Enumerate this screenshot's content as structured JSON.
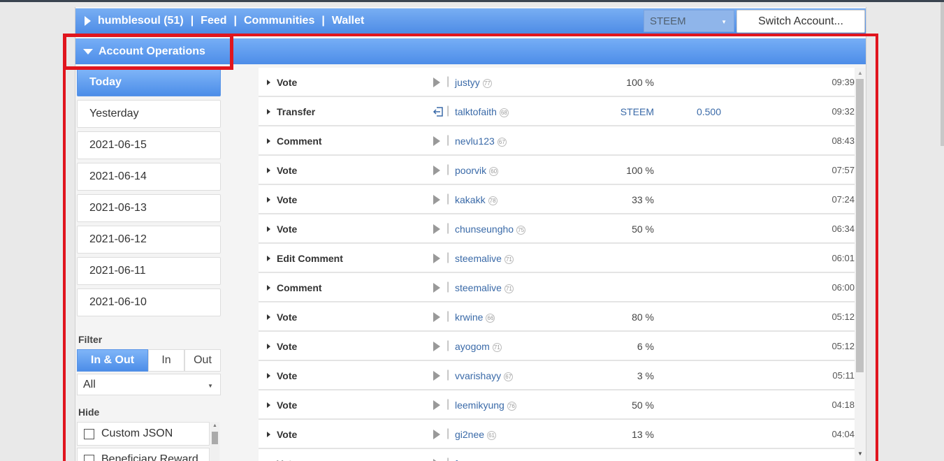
{
  "topbar": {
    "nav": [
      "humblesoul (51)",
      "Feed",
      "Communities",
      "Wallet"
    ],
    "separator": "|",
    "currency": "STEEM",
    "switch_label": "Switch Account..."
  },
  "ops": {
    "title": "Account Operations"
  },
  "sidebar": {
    "days": [
      "Today",
      "Yesterday",
      "2021-06-15",
      "2021-06-14",
      "2021-06-13",
      "2021-06-12",
      "2021-06-11",
      "2021-06-10"
    ],
    "filter_label": "Filter",
    "filter_options": [
      "In & Out",
      "In",
      "Out"
    ],
    "select_value": "All",
    "hide_label": "Hide",
    "hide_items": [
      "Custom JSON",
      "Beneficiary Reward"
    ]
  },
  "operations": [
    {
      "type": "Vote",
      "dir": "play",
      "user": "justyy",
      "rep": "77",
      "value": "100 %",
      "amount": "",
      "time": "09:39"
    },
    {
      "type": "Transfer",
      "dir": "in",
      "user": "talktofaith",
      "rep": "68",
      "value": "STEEM",
      "amount": "0.500",
      "time": "09:32"
    },
    {
      "type": "Comment",
      "dir": "play",
      "user": "nevlu123",
      "rep": "67",
      "value": "",
      "amount": "",
      "time": "08:43"
    },
    {
      "type": "Vote",
      "dir": "play",
      "user": "poorvik",
      "rep": "60",
      "value": "100 %",
      "amount": "",
      "time": "07:57"
    },
    {
      "type": "Vote",
      "dir": "play",
      "user": "kakakk",
      "rep": "78",
      "value": "33 %",
      "amount": "",
      "time": "07:24"
    },
    {
      "type": "Vote",
      "dir": "play",
      "user": "chunseungho",
      "rep": "75",
      "value": "50 %",
      "amount": "",
      "time": "06:34"
    },
    {
      "type": "Edit Comment",
      "dir": "play",
      "user": "steemalive",
      "rep": "71",
      "value": "",
      "amount": "",
      "time": "06:01"
    },
    {
      "type": "Comment",
      "dir": "play",
      "user": "steemalive",
      "rep": "71",
      "value": "",
      "amount": "",
      "time": "06:00"
    },
    {
      "type": "Vote",
      "dir": "play",
      "user": "krwine",
      "rep": "66",
      "value": "80 %",
      "amount": "",
      "time": "05:12"
    },
    {
      "type": "Vote",
      "dir": "play",
      "user": "ayogom",
      "rep": "71",
      "value": "6 %",
      "amount": "",
      "time": "05:12"
    },
    {
      "type": "Vote",
      "dir": "play",
      "user": "vvarishayy",
      "rep": "67",
      "value": "3 %",
      "amount": "",
      "time": "05:11"
    },
    {
      "type": "Vote",
      "dir": "play",
      "user": "leemikyung",
      "rep": "76",
      "value": "50 %",
      "amount": "",
      "time": "04:18"
    },
    {
      "type": "Vote",
      "dir": "play",
      "user": "gi2nee",
      "rep": "61",
      "value": "13 %",
      "amount": "",
      "time": "04:04"
    },
    {
      "type": "Vote",
      "dir": "play",
      "user": "fur",
      "rep": "",
      "value": "",
      "amount": "",
      "time": ""
    }
  ],
  "colors": {
    "accent": "#4e8ce6",
    "highlight": "#e0151e",
    "link": "#3a6aa8"
  }
}
